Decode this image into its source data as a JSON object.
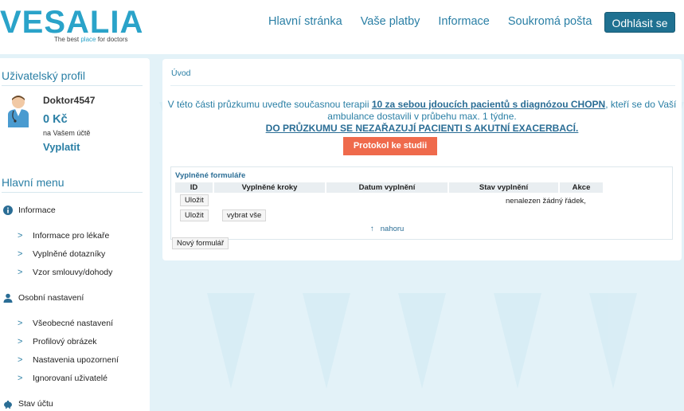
{
  "brand": {
    "logo_text": "VESALIA",
    "tagline_pre": "The best ",
    "tagline_hl": "place",
    "tagline_post": " for doctors",
    "color": "#2aa3c9"
  },
  "nav": {
    "items": [
      "Hlavní stránka",
      "Vaše platby",
      "Informace",
      "Soukromá pošta"
    ],
    "logout_label": "Odhlásit se"
  },
  "sidebar": {
    "profile_heading": "Uživatelský profil",
    "username": "Doktor4547",
    "balance": "0 Kč",
    "balance_sub": "na Vašem účtě",
    "pay_label": "Vyplatit",
    "menu_heading": "Hlavní menu",
    "sections": [
      {
        "label": "Informace",
        "icon": "info-icon",
        "items": [
          "Informace pro lékaře",
          "Vyplněné dotazníky",
          "Vzor smlouvy/dohody"
        ]
      },
      {
        "label": "Osobní nastavení",
        "icon": "person-icon",
        "items": [
          "Všeobecné nastavení",
          "Profilový obrázek",
          "Nastavenia upozornení",
          "Ignorovaní uživatelé"
        ]
      },
      {
        "label": "Stav účtu",
        "icon": "piggy-bank-icon",
        "items": []
      }
    ]
  },
  "main": {
    "breadcrumb": "Úvod",
    "intro_1": "V této části průzkumu uveďte současnou terapii ",
    "intro_link": "10 za sebou jdoucích pacientů s diagnózou CHOPN",
    "intro_2": ", kteří se do Vaší ambulance dostavili v průbehu max. 1 týdne.",
    "intro_warning": "DO PRŮZKUMU SE NEZAŘAZUJÍ PACIENTI S AKUTNÍ EXACERBACÍ.",
    "protocol_label": "Protokol ke studii",
    "forms": {
      "title": "Vyplněné formuláře",
      "columns": [
        "ID",
        "Vyplněné kroky",
        "Datum vyplnění",
        "Stav vyplnění",
        "Akce"
      ],
      "empty_text": "nenalezen žádný řádek,",
      "save_label": "Uložit",
      "select_all_label": "vybrat vše",
      "up_arrow": "↑",
      "up_label": "nahoru"
    },
    "new_form_label": "Nový formulář"
  },
  "colors": {
    "accent": "#2a7fa5",
    "button_dark": "#1f7191",
    "protocol": "#ef6a4c",
    "background": "#e3f2f8"
  }
}
